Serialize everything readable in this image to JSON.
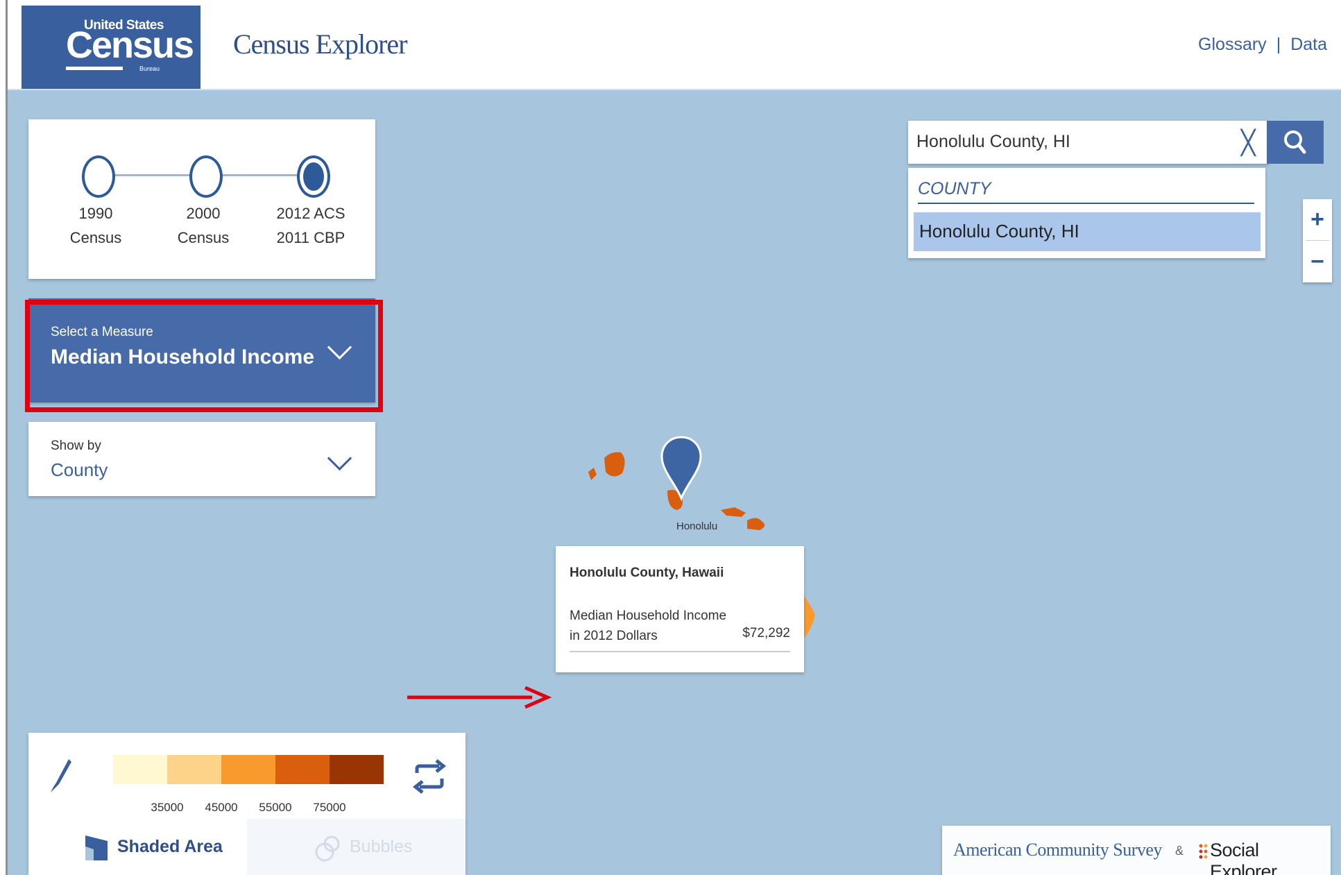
{
  "header": {
    "logo": {
      "line1": "United States",
      "line2": "Census",
      "line3": "Bureau"
    },
    "app_title": "Census Explorer",
    "links": [
      "Glossary",
      "Data"
    ],
    "link_separator": "|"
  },
  "timeline": {
    "items": [
      {
        "line1": "1990",
        "line2": "Census",
        "selected": false
      },
      {
        "line1": "2000",
        "line2": "Census",
        "selected": false
      },
      {
        "line1": "2012 ACS",
        "line2": "2011 CBP",
        "selected": true
      }
    ]
  },
  "measure": {
    "label": "Select a Measure",
    "value": "Median Household Income"
  },
  "show_by": {
    "label": "Show by",
    "value": "County"
  },
  "search": {
    "value": "Honolulu County, HI",
    "results_header": "COUNTY",
    "results": [
      "Honolulu County, HI"
    ]
  },
  "zoom": {
    "in": "+",
    "out": "−"
  },
  "map": {
    "city_label": "Honolulu"
  },
  "tooltip": {
    "title": "Honolulu County, Hawaii",
    "measure": "Median Household Income in 2012 Dollars",
    "value": "$72,292"
  },
  "legend": {
    "colors": [
      "#fff8d0",
      "#fdd389",
      "#f89a2e",
      "#d95f0e",
      "#993404"
    ],
    "ticks": [
      "35000",
      "45000",
      "55000",
      "75000"
    ],
    "tabs": [
      "Shaded Area",
      "Bubbles"
    ],
    "active_tab": "Shaded Area"
  },
  "footer": {
    "acs": "American Community Survey",
    "amp": "&",
    "se": "Social Explorer"
  },
  "colors": {
    "primary": "#3a5f9e",
    "map_water": "#a7c5dc",
    "highlight": "#e00010"
  }
}
